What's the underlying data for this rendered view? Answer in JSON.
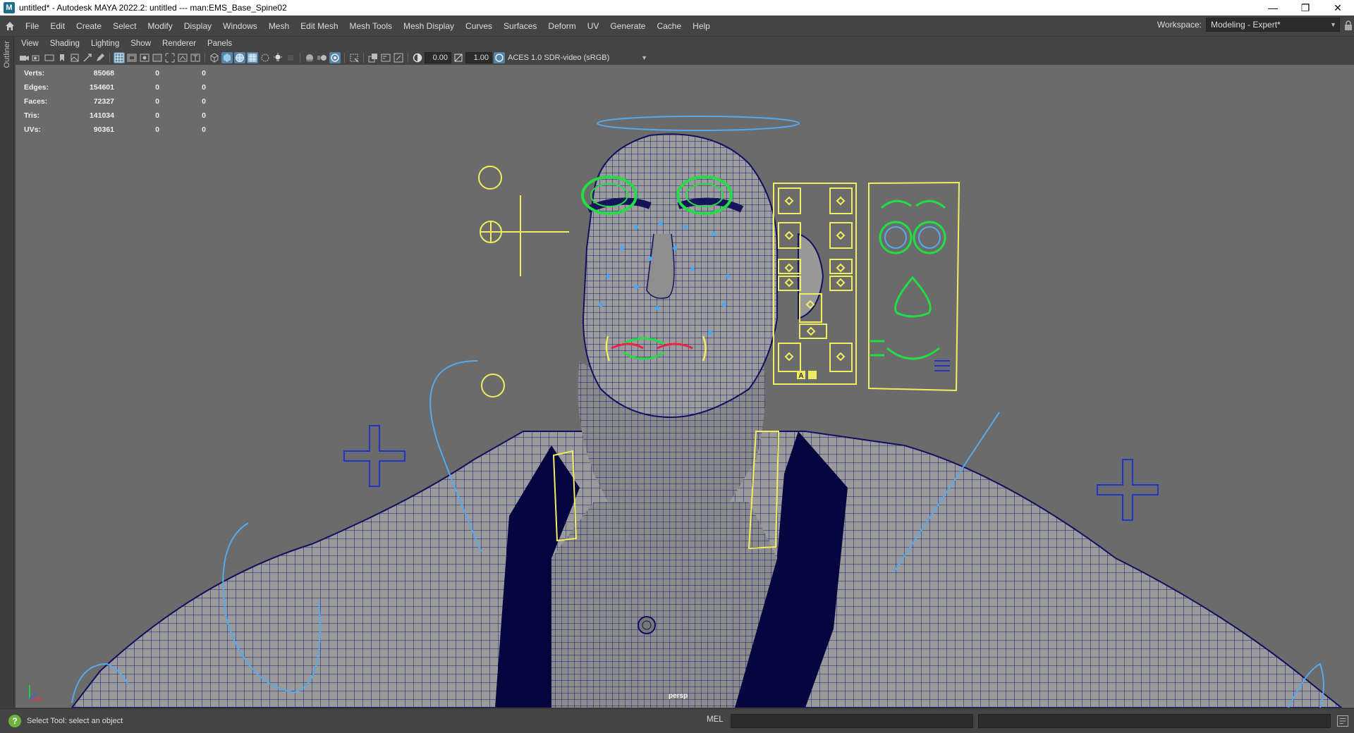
{
  "window": {
    "title": "untitled* - Autodesk MAYA 2022.2: untitled   ---   man:EMS_Base_Spine02",
    "minimize": "—",
    "maximize": "❐",
    "close": "✕"
  },
  "menubar": {
    "items": [
      "File",
      "Edit",
      "Create",
      "Select",
      "Modify",
      "Display",
      "Windows",
      "Mesh",
      "Edit Mesh",
      "Mesh Tools",
      "Mesh Display",
      "Curves",
      "Surfaces",
      "Deform",
      "UV",
      "Generate",
      "Cache",
      "Help"
    ],
    "workspace_label": "Workspace:",
    "workspace_value": "Modeling - Expert*"
  },
  "outliner_strip": {
    "label": "Outliner"
  },
  "panel_menu": {
    "items": [
      "View",
      "Shading",
      "Lighting",
      "Show",
      "Renderer",
      "Panels"
    ]
  },
  "panel_toolbar": {
    "near_clip": "0.00",
    "gamma": "1.00",
    "color_space": "ACES 1.0 SDR-video (sRGB)"
  },
  "hud": {
    "rows": [
      {
        "label": "Verts:",
        "v1": "85068",
        "v2": "0",
        "v3": "0"
      },
      {
        "label": "Edges:",
        "v1": "154601",
        "v2": "0",
        "v3": "0"
      },
      {
        "label": "Faces:",
        "v1": "72327",
        "v2": "0",
        "v3": "0"
      },
      {
        "label": "Tris:",
        "v1": "141034",
        "v2": "0",
        "v3": "0"
      },
      {
        "label": "UVs:",
        "v1": "90361",
        "v2": "0",
        "v3": "0"
      }
    ]
  },
  "viewport": {
    "camera": "persp"
  },
  "face_panel": {
    "btn_a": "A"
  },
  "status": {
    "help_line": "Select Tool: select an object",
    "mel_label": "MEL"
  },
  "colors": {
    "viewport_bg": "#6b6b6b",
    "wire": "#1a1a7a",
    "ctrl_yellow": "#f0ee60",
    "ctrl_green": "#22dd44",
    "ctrl_blue": "#55aaee",
    "ctrl_navy": "#2233cc"
  }
}
